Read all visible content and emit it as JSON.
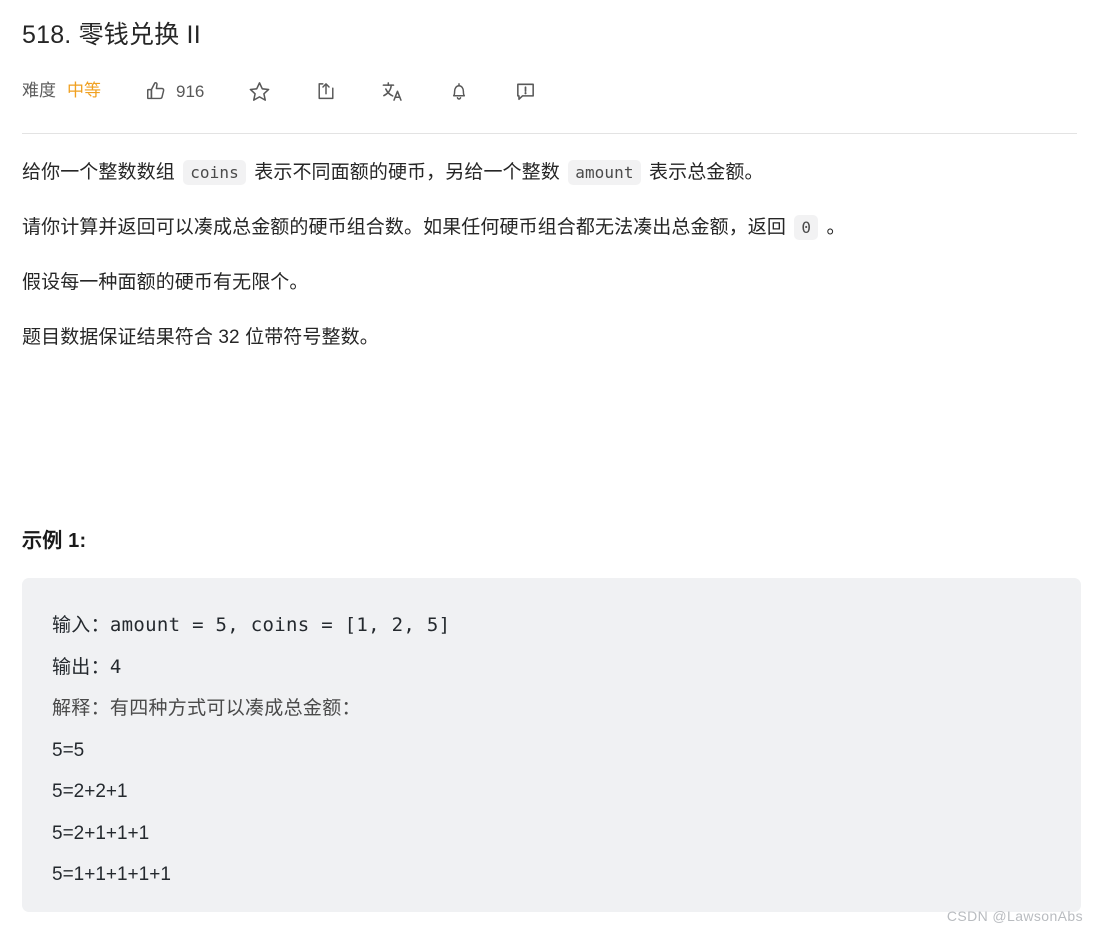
{
  "header": {
    "title": "518. 零钱兑换 II",
    "difficulty_label": "难度",
    "difficulty_value": "中等",
    "difficulty_color": "#f0a020",
    "like_count": "916",
    "actions": [
      {
        "name": "thumbs-up-icon",
        "label": "916"
      },
      {
        "name": "star-icon",
        "label": ""
      },
      {
        "name": "share-icon",
        "label": ""
      },
      {
        "name": "translate-icon",
        "label": ""
      },
      {
        "name": "bell-icon",
        "label": ""
      },
      {
        "name": "feedback-icon",
        "label": ""
      }
    ]
  },
  "description": {
    "p1_a": "给你一个整数数组 ",
    "p1_code1": "coins",
    "p1_b": " 表示不同面额的硬币，另给一个整数 ",
    "p1_code2": "amount",
    "p1_c": " 表示总金额。",
    "p2_a": "请你计算并返回可以凑成总金额的硬币组合数。如果任何硬币组合都无法凑出总金额，返回 ",
    "p2_code1": "0",
    "p2_b": " 。",
    "p3": "假设每一种面额的硬币有无限个。",
    "p4": "题目数据保证结果符合 32 位带符号整数。"
  },
  "example": {
    "heading": "示例 1:",
    "lines": [
      {
        "prefix": "输入：",
        "rest": "amount = 5, coins = [1, 2, 5]",
        "style": "mono"
      },
      {
        "prefix": "输出：",
        "rest": "4",
        "style": "mono"
      },
      {
        "prefix": "解释：",
        "rest": "有四种方式可以凑成总金额：",
        "style": "serif-dim"
      },
      {
        "prefix": "",
        "rest": "5=5",
        "style": "sans"
      },
      {
        "prefix": "",
        "rest": "5=2+2+1",
        "style": "sans"
      },
      {
        "prefix": "",
        "rest": "5=2+1+1+1",
        "style": "sans"
      },
      {
        "prefix": "",
        "rest": "5=1+1+1+1+1",
        "style": "sans"
      }
    ]
  },
  "watermark": "CSDN @LawsonAbs"
}
